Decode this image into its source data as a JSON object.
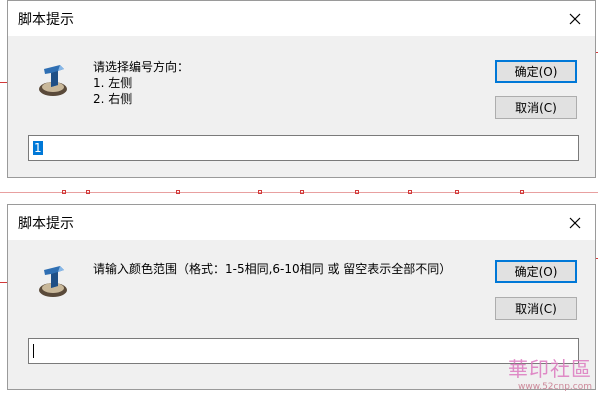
{
  "colors": {
    "accent": "#0078d7",
    "dialog_bg": "#f0f0f0",
    "cad_red": "#d23a3a"
  },
  "dialog1": {
    "title": "脚本提示",
    "close_icon": "close-icon",
    "prompt_lines": [
      "请选择编号方向：",
      "1. 左侧",
      "2. 右侧"
    ],
    "ok_label": "确定(O)",
    "cancel_label": "取消(C)",
    "input_value": "1"
  },
  "dialog2": {
    "title": "脚本提示",
    "close_icon": "close-icon",
    "prompt_lines": [
      "请输入颜色范围（格式：1-5相同,6-10相同 或 留空表示全部不同）"
    ],
    "ok_label": "确定(O)",
    "cancel_label": "取消(C)",
    "input_value": ""
  },
  "watermark": {
    "text": "華印社區",
    "url": "www.52cnp.com"
  }
}
